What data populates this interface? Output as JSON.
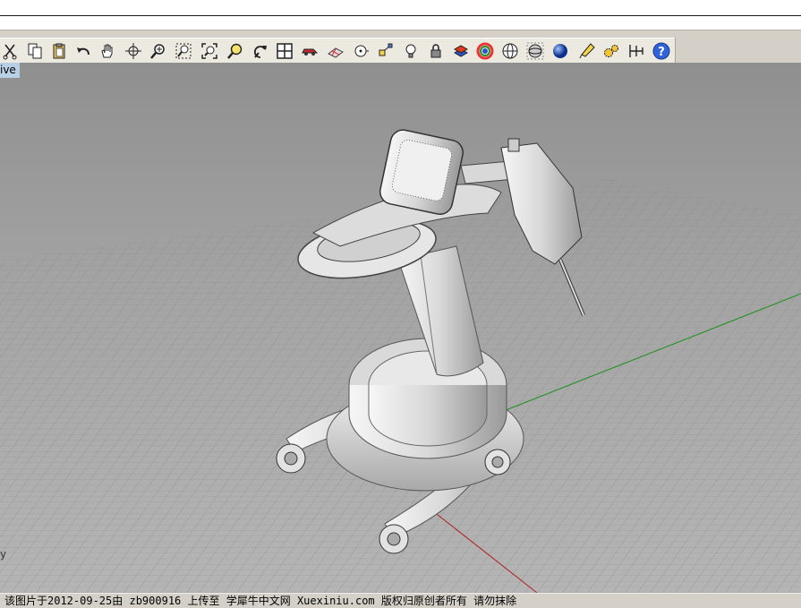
{
  "command_line": {
    "text": ""
  },
  "toolbar": {
    "buttons": [
      {
        "icon": "cut-icon"
      },
      {
        "icon": "copy-icon"
      },
      {
        "icon": "paste-icon"
      },
      {
        "icon": "undo-icon"
      },
      {
        "icon": "pan-hand-icon"
      },
      {
        "icon": "rotate-view-icon"
      },
      {
        "icon": "zoom-icon"
      },
      {
        "icon": "zoom-window-icon"
      },
      {
        "icon": "zoom-extents-icon"
      },
      {
        "icon": "zoom-selected-icon"
      },
      {
        "icon": "undo-view-icon"
      },
      {
        "icon": "viewports-icon"
      },
      {
        "icon": "car-object-icon"
      },
      {
        "icon": "cplane-icon"
      },
      {
        "icon": "snap-point-icon"
      },
      {
        "icon": "osnap-icon"
      },
      {
        "icon": "light-bulb-icon"
      },
      {
        "icon": "lock-icon"
      },
      {
        "icon": "layer-color-icon"
      },
      {
        "icon": "color-wheel-icon"
      },
      {
        "icon": "wireframe-sphere-icon"
      },
      {
        "icon": "ghosted-sphere-icon"
      },
      {
        "icon": "rendered-sphere-icon"
      },
      {
        "icon": "spotlight-icon"
      },
      {
        "icon": "options-gears-icon"
      },
      {
        "icon": "dimension-icon"
      },
      {
        "icon": "help-icon"
      }
    ]
  },
  "viewport": {
    "label": "ive",
    "axis_mark": "y",
    "colors": {
      "x_axis": "#b02020",
      "y_axis": "#1f8f1f",
      "grid": "#8a8a8a"
    }
  },
  "status": {
    "text": "该图片于2012-09-25由 zb900916 上传至 学犀牛中文网 Xuexiniu.com 版权归原创者所有 请勿抹除"
  }
}
